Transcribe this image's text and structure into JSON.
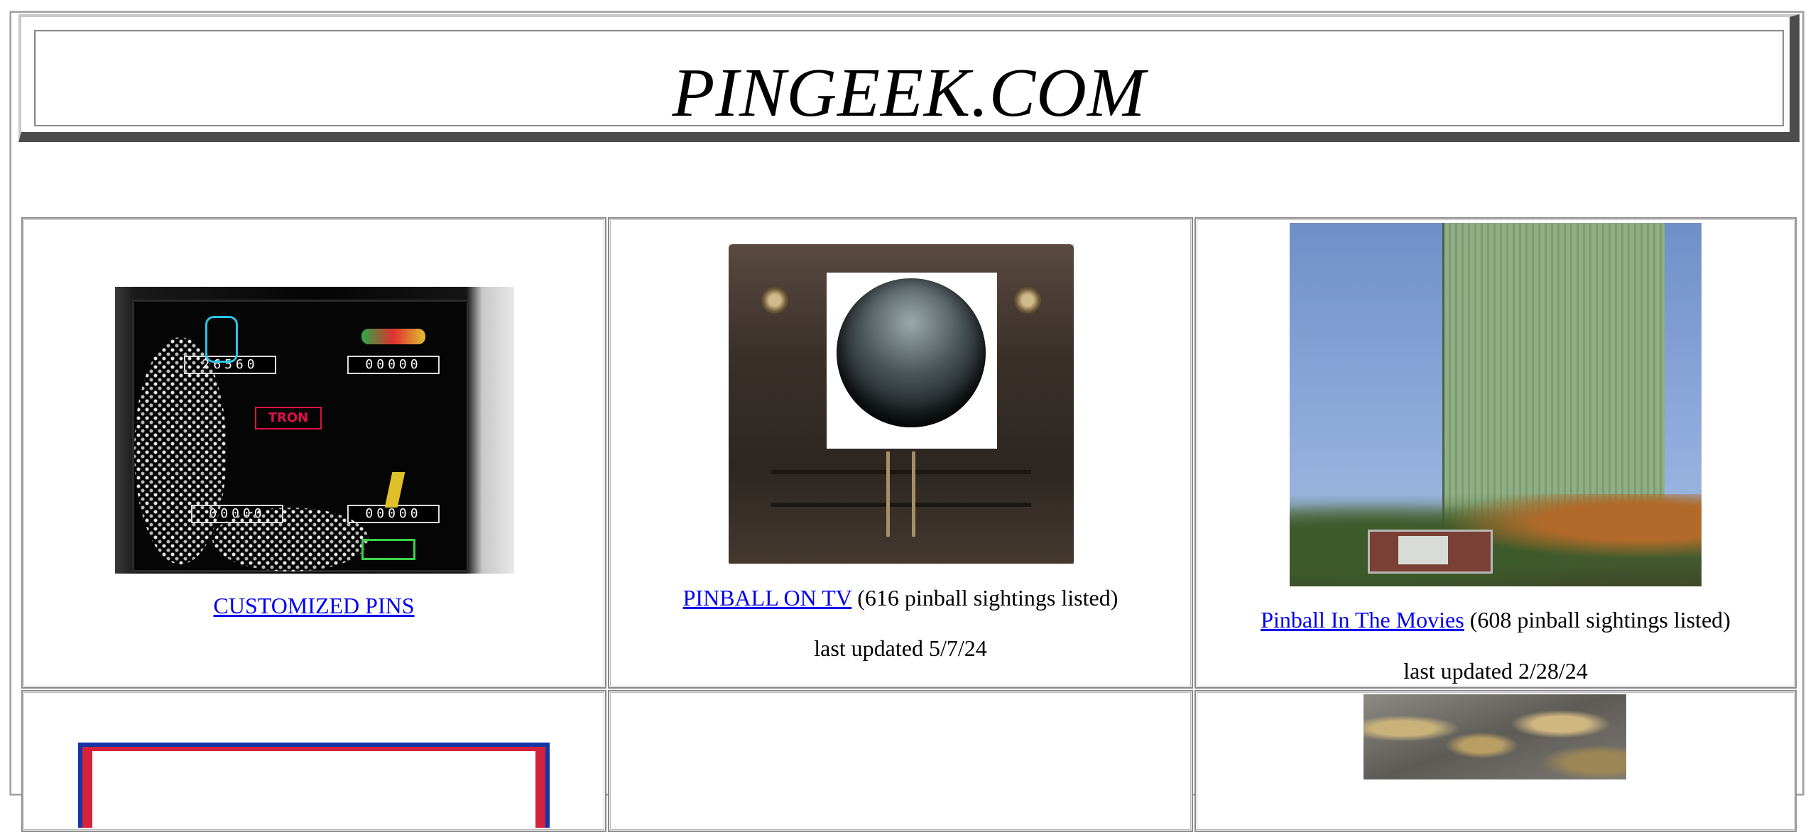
{
  "site": {
    "title": "PINGEEK.COM"
  },
  "tiles": [
    {
      "link_text": "CUSTOMIZED PINS",
      "image": "tron-pinball-backglass",
      "scores": [
        "26560",
        "00000",
        "00000",
        "00000"
      ]
    },
    {
      "link_text": "PINBALL ON TV",
      "count_text": "(616 pinball sightings listed)",
      "updated_text": "last updated 5/7/24",
      "image": "vintage-television"
    },
    {
      "link_text": "Pinball In The Movies",
      "count_text": "(608 pinball sightings listed)",
      "updated_text": "last updated 2/28/24",
      "image": "drive-in-movie-screen"
    }
  ],
  "row2": {
    "left_image": "framed-poster",
    "right_image": "pinball-bulbs"
  }
}
